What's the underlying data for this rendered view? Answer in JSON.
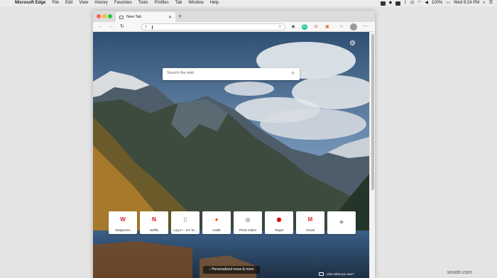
{
  "menubar": {
    "app": "Microsoft Edge",
    "menus": [
      "File",
      "Edit",
      "View",
      "History",
      "Favorites",
      "Tools",
      "Profiles",
      "Tab",
      "Window",
      "Help"
    ],
    "battery": "100%",
    "clock": "Wed 9:24 PM"
  },
  "browser": {
    "tab_title": "New Tab",
    "address_value": "",
    "search_placeholder": "Search the web",
    "tiles": [
      {
        "label": "Walgreens",
        "icon": "walgreens-icon",
        "color": "#e31837",
        "glyph": "W"
      },
      {
        "label": "Netflix",
        "icon": "netflix-icon",
        "color": "#e50914",
        "glyph": "N"
      },
      {
        "label": "Log in – IoT Te...",
        "icon": "page-icon",
        "color": "#777777",
        "glyph": "▯"
      },
      {
        "label": "reddit",
        "icon": "reddit-icon",
        "color": "#ff4500",
        "glyph": "●"
      },
      {
        "label": "Photo Editor",
        "icon": "photo-editor-icon",
        "color": "#555555",
        "glyph": "◎"
      },
      {
        "label": "Target",
        "icon": "target-icon",
        "color": "#cc0000",
        "glyph": "◉"
      },
      {
        "label": "Gmail",
        "icon": "gmail-icon",
        "color": "#d93025",
        "glyph": "M"
      }
    ],
    "add_tile_glyph": "+",
    "news_button": "↓ Personalized news & more",
    "like_text": "Like what you see?"
  },
  "watermark": "wsxdn.com",
  "colors": {
    "menubar": "#ececec",
    "window_chrome": "#dcdcdc",
    "toolbar": "#f7f7f7"
  }
}
